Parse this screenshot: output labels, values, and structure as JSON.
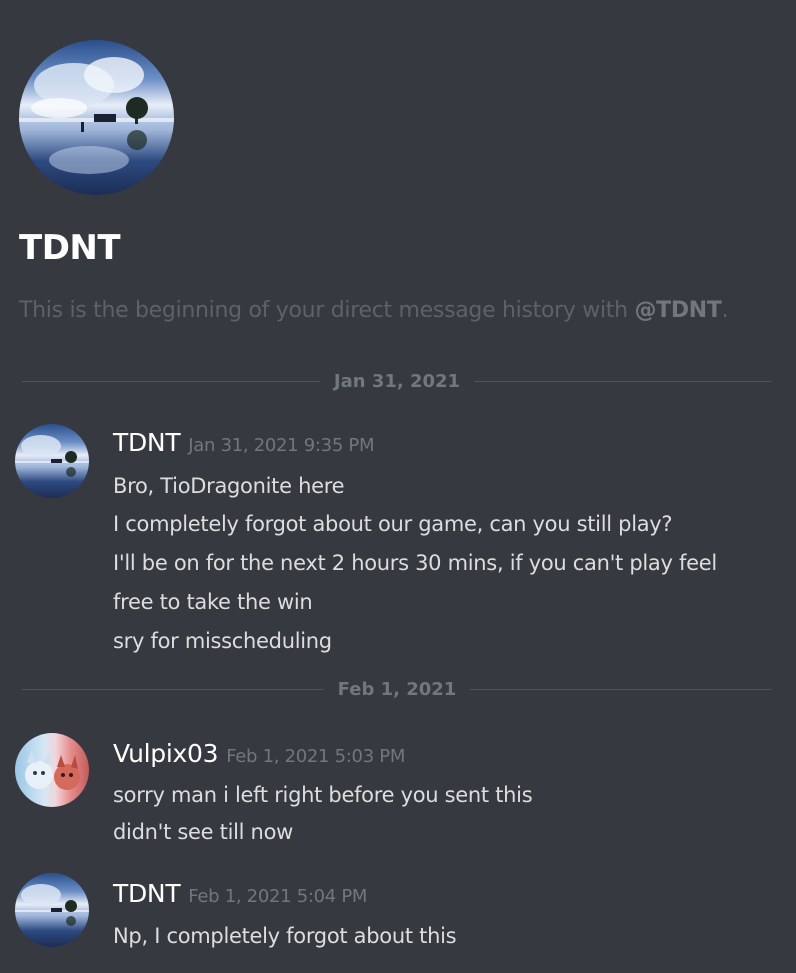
{
  "channel": {
    "title": "TDNT",
    "intro_prefix": "This is the beginning of your direct message history with ",
    "intro_mention": "@TDNT",
    "intro_suffix": "."
  },
  "dividers": [
    "Jan 31, 2021",
    "Feb 1, 2021"
  ],
  "messages": [
    {
      "username": "TDNT",
      "timestamp": "Jan 31, 2021 9:35 PM",
      "avatar": "tdnt-avatar",
      "lines": [
        "Bro, TioDragonite here",
        "I completely forgot about our game, can you still play?",
        "I'll be on for the next 2 hours 30 mins, if you can't play feel",
        "free to take the win",
        "sry for misscheduling"
      ]
    },
    {
      "username": "Vulpix03",
      "timestamp": "Feb 1, 2021 5:03 PM",
      "avatar": "vulpix-avatar",
      "lines": [
        "sorry man i left right before you sent this",
        "didn't see till now"
      ]
    },
    {
      "username": "TDNT",
      "timestamp": "Feb 1, 2021 5:04 PM",
      "avatar": "tdnt-avatar",
      "lines": [
        "Np, I completely forgot about this"
      ]
    }
  ],
  "colors": {
    "background": "#36393f",
    "username": "#ffffff",
    "message_text": "#dcddde",
    "muted": "#72767d"
  }
}
